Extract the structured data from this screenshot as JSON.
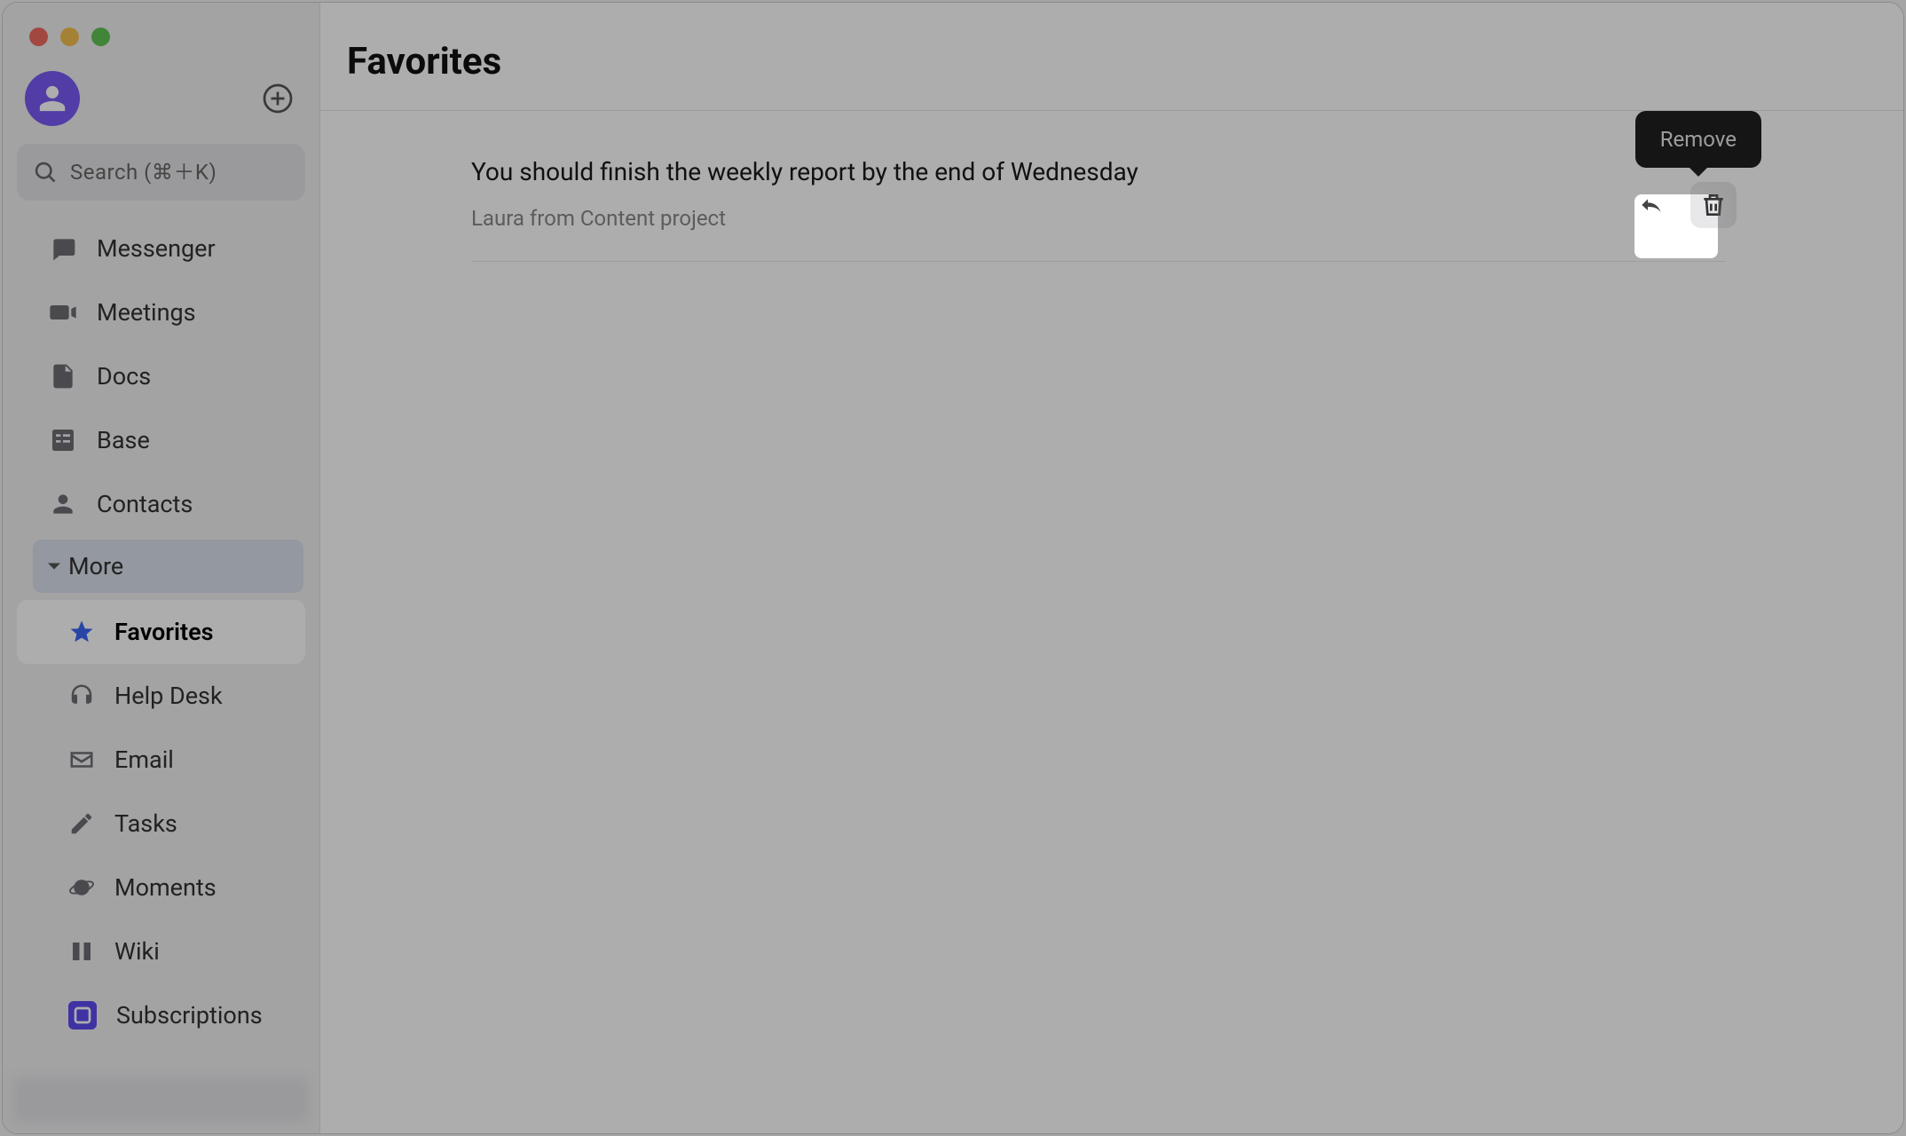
{
  "search": {
    "placeholder": "Search (⌘＋K)"
  },
  "sidebar": {
    "nav": [
      {
        "label": "Messenger"
      },
      {
        "label": "Meetings"
      },
      {
        "label": "Docs"
      },
      {
        "label": "Base"
      },
      {
        "label": "Contacts"
      }
    ],
    "more_label": "More",
    "sub": [
      {
        "label": "Favorites"
      },
      {
        "label": "Help Desk"
      },
      {
        "label": "Email"
      },
      {
        "label": "Tasks"
      },
      {
        "label": "Moments"
      },
      {
        "label": "Wiki"
      },
      {
        "label": "Subscriptions"
      }
    ]
  },
  "main": {
    "title": "Favorites",
    "items": [
      {
        "text": "You should finish the weekly report by the end of Wednesday",
        "meta": "Laura from Content project"
      }
    ]
  },
  "tooltip": {
    "remove": "Remove"
  }
}
